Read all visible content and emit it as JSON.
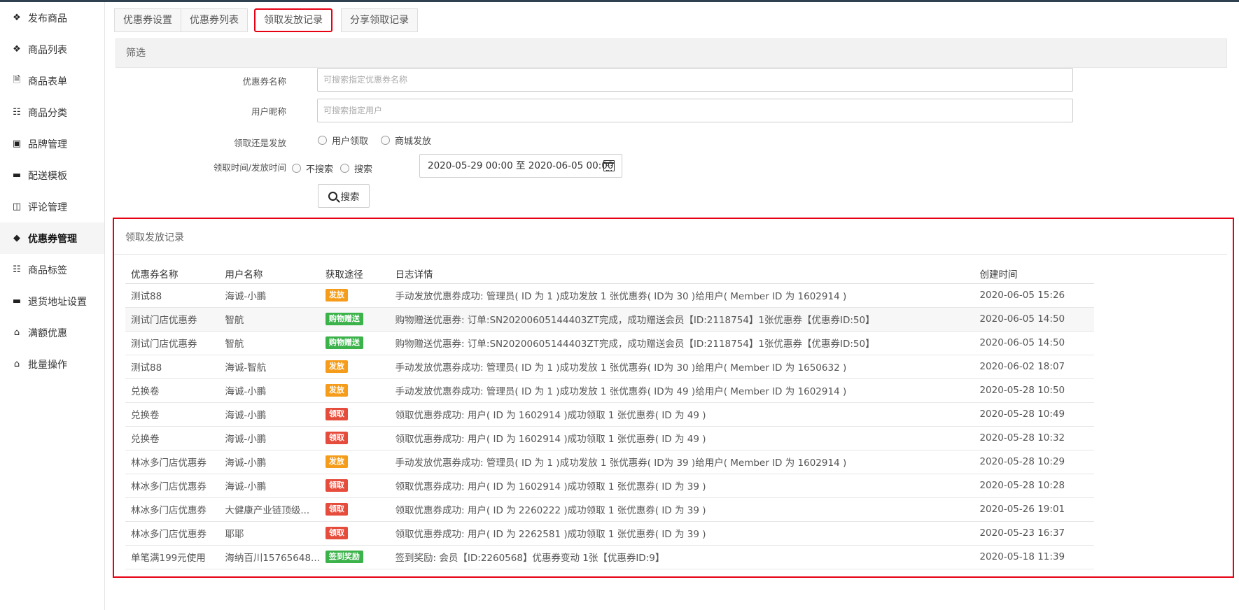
{
  "sidebar": {
    "items": [
      {
        "label": "发布商品",
        "icon": "cubes-icon"
      },
      {
        "label": "商品列表",
        "icon": "cubes-icon"
      },
      {
        "label": "商品表单",
        "icon": "file-icon"
      },
      {
        "label": "商品分类",
        "icon": "sitemap-icon"
      },
      {
        "label": "品牌管理",
        "icon": "briefcase-icon"
      },
      {
        "label": "配送模板",
        "icon": "truck-icon"
      },
      {
        "label": "评论管理",
        "icon": "columns-icon"
      },
      {
        "label": "优惠券管理",
        "icon": "tags-icon",
        "active": true
      },
      {
        "label": "商品标签",
        "icon": "sitemap-icon"
      },
      {
        "label": "退货地址设置",
        "icon": "truck-icon"
      },
      {
        "label": "满额优惠",
        "icon": "gift-icon"
      },
      {
        "label": "批量操作",
        "icon": "gift-icon"
      }
    ]
  },
  "tabs": [
    "优惠券设置",
    "优惠券列表",
    "领取发放记录",
    "分享领取记录"
  ],
  "active_tab": 2,
  "filter": {
    "heading": "筛选",
    "coupon_name_label": "优惠券名称",
    "coupon_name_placeholder": "可搜索指定优惠券名称",
    "nickname_label": "用户昵称",
    "nickname_placeholder": "可搜索指定用户",
    "source_label": "领取还是发放",
    "source_option_1": "用户领取",
    "source_option_2": "商城发放",
    "time_label": "领取时间/发放时间",
    "time_option_1": "不搜索",
    "time_option_2": "搜索",
    "date_range": "2020-05-29 00:00 至 2020-06-05 00:00",
    "search_button": "搜索"
  },
  "records": {
    "title": "领取发放记录",
    "columns": [
      "优惠券名称",
      "用户名称",
      "获取途径",
      "日志详情",
      "创建时间"
    ],
    "rows": [
      {
        "coupon": "测试88",
        "user": "海诚-小鹏",
        "channel": "发放",
        "detail": "手动发放优惠券成功: 管理员( ID 为 1 )成功发放 1 张优惠券( ID为 30 )给用户( Member ID 为 1602914 )",
        "time": "2020-06-05 15:26"
      },
      {
        "coupon": "测试门店优惠券",
        "user": "智航",
        "channel": "购物赠送",
        "detail": "购物赠送优惠券: 订单:SN20200605144403ZT完成，成功赠送会员【ID:2118754】1张优惠券【优惠券ID:50】",
        "time": "2020-06-05 14:50"
      },
      {
        "coupon": "测试门店优惠券",
        "user": "智航",
        "channel": "购物赠送",
        "detail": "购物赠送优惠券: 订单:SN20200605144403ZT完成，成功赠送会员【ID:2118754】1张优惠券【优惠券ID:50】",
        "time": "2020-06-05 14:50"
      },
      {
        "coupon": "测试88",
        "user": "海诚-智航",
        "channel": "发放",
        "detail": "手动发放优惠券成功: 管理员( ID 为 1 )成功发放 1 张优惠券( ID为 30 )给用户( Member ID 为 1650632 )",
        "time": "2020-06-02 18:07"
      },
      {
        "coupon": "兑换卷",
        "user": "海诚-小鹏",
        "channel": "发放",
        "detail": "手动发放优惠券成功: 管理员( ID 为 1 )成功发放 1 张优惠券( ID为 49 )给用户( Member ID 为 1602914 )",
        "time": "2020-05-28 10:50"
      },
      {
        "coupon": "兑换卷",
        "user": "海诚-小鹏",
        "channel": "领取",
        "detail": "领取优惠券成功: 用户( ID 为 1602914 )成功领取 1 张优惠券( ID 为 49 )",
        "time": "2020-05-28 10:49"
      },
      {
        "coupon": "兑换卷",
        "user": "海诚-小鹏",
        "channel": "领取",
        "detail": "领取优惠券成功: 用户( ID 为 1602914 )成功领取 1 张优惠券( ID 为 49 )",
        "time": "2020-05-28 10:32"
      },
      {
        "coupon": "林冰多门店优惠券",
        "user": "海诚-小鹏",
        "channel": "发放",
        "detail": "手动发放优惠券成功: 管理员( ID 为 1 )成功发放 1 张优惠券( ID为 39 )给用户( Member ID 为 1602914 )",
        "time": "2020-05-28 10:29"
      },
      {
        "coupon": "林冰多门店优惠券",
        "user": "海诚-小鹏",
        "channel": "领取",
        "detail": "领取优惠券成功: 用户( ID 为 1602914 )成功领取 1 张优惠券( ID 为 39 )",
        "time": "2020-05-28 10:28"
      },
      {
        "coupon": "林冰多门店优惠券",
        "user": "大健康产业链顶级...",
        "channel": "领取",
        "detail": "领取优惠券成功: 用户( ID 为 2260222 )成功领取 1 张优惠券( ID 为 39 )",
        "time": "2020-05-26 19:01"
      },
      {
        "coupon": "林冰多门店优惠券",
        "user": "耶耶",
        "channel": "领取",
        "detail": "领取优惠券成功: 用户( ID 为 2262581 )成功领取 1 张优惠券( ID 为 39 )",
        "time": "2020-05-23 16:37"
      },
      {
        "coupon": "单笔满199元使用",
        "user": "海纳百川15765648...",
        "channel": "签到奖励",
        "detail": "签到奖励: 会员【ID:2260568】优惠券变动 1张【优惠券ID:9】",
        "time": "2020-05-18 11:39"
      }
    ]
  },
  "colors": {
    "badge_发放": "#f59c1a",
    "badge_领取": "#e64c3c",
    "badge_购物赠送": "#3cb24b",
    "badge_签到奖励": "#3cb24b",
    "highlight": "#e60012"
  }
}
